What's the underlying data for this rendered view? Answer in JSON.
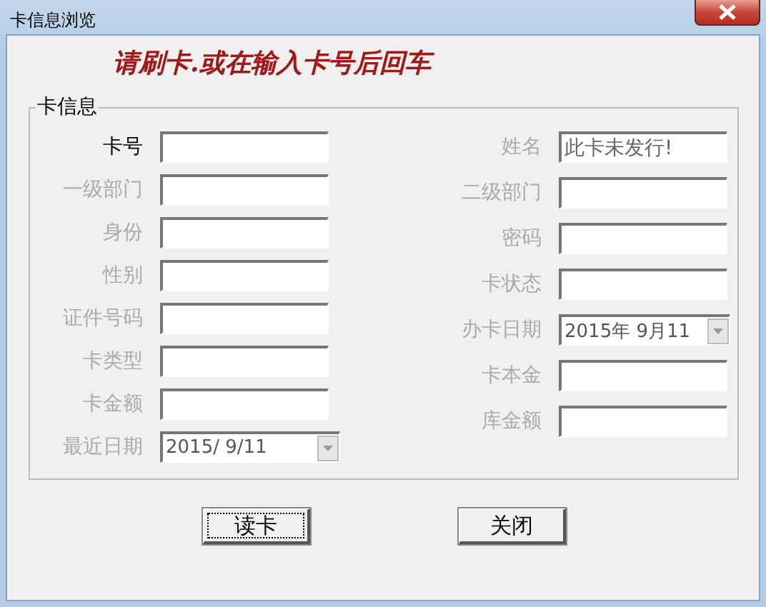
{
  "window": {
    "title": "卡信息浏览"
  },
  "prompt": "请刷卡.或在输入卡号后回车",
  "group": {
    "title": "卡信息"
  },
  "left_fields": [
    {
      "label": "卡号",
      "kind": "text",
      "disabled": false
    },
    {
      "label": "一级部门",
      "kind": "text",
      "disabled": true
    },
    {
      "label": "身份",
      "kind": "text",
      "disabled": true
    },
    {
      "label": "性别",
      "kind": "text",
      "disabled": true
    },
    {
      "label": "证件号码",
      "kind": "text",
      "disabled": true
    },
    {
      "label": "卡类型",
      "kind": "text",
      "disabled": true
    },
    {
      "label": "卡金额",
      "kind": "text",
      "disabled": true
    },
    {
      "label": "最近日期",
      "kind": "date",
      "value": "2015/ 9/11",
      "disabled": true
    }
  ],
  "right_fields": [
    {
      "label": "姓名",
      "kind": "text",
      "value": "此卡未发行!",
      "disabled": true
    },
    {
      "label": "二级部门",
      "kind": "text",
      "disabled": true
    },
    {
      "label": "密码",
      "kind": "text",
      "disabled": true
    },
    {
      "label": "卡状态",
      "kind": "text",
      "disabled": true
    },
    {
      "label": "办卡日期",
      "kind": "date",
      "value": "2015年  9月11",
      "disabled": true
    },
    {
      "label": "卡本金",
      "kind": "text",
      "disabled": true
    },
    {
      "label": "库金额",
      "kind": "text",
      "disabled": true
    }
  ],
  "buttons": [
    {
      "label": "读卡",
      "focused": true
    },
    {
      "label": "关闭",
      "focused": false
    }
  ]
}
